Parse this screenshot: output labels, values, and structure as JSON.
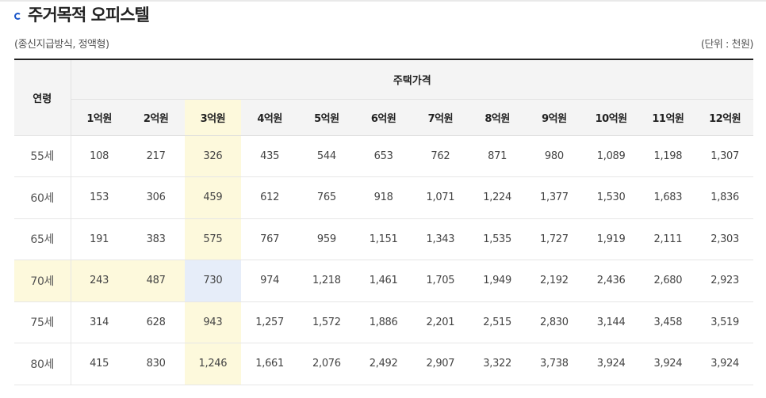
{
  "title": "주거목적 오피스텔",
  "subtitle_left": "(종신지급방식, 정액형)",
  "subtitle_right": "(단위 : 천원)",
  "colors": {
    "bullet": "#1a56c9",
    "highlight": "#fdf9dc",
    "intersection": "#e6edf9"
  },
  "table": {
    "age_header": "연령",
    "group_header": "주택가격",
    "columns": [
      "1억원",
      "2억원",
      "3억원",
      "4억원",
      "5억원",
      "6억원",
      "7억원",
      "8억원",
      "9억원",
      "10억원",
      "11억원",
      "12억원"
    ],
    "highlight_column_index": 2,
    "highlight_row_index": 3,
    "rows": [
      {
        "age": "55세",
        "values": [
          "108",
          "217",
          "326",
          "435",
          "544",
          "653",
          "762",
          "871",
          "980",
          "1,089",
          "1,198",
          "1,307"
        ]
      },
      {
        "age": "60세",
        "values": [
          "153",
          "306",
          "459",
          "612",
          "765",
          "918",
          "1,071",
          "1,224",
          "1,377",
          "1,530",
          "1,683",
          "1,836"
        ]
      },
      {
        "age": "65세",
        "values": [
          "191",
          "383",
          "575",
          "767",
          "959",
          "1,151",
          "1,343",
          "1,535",
          "1,727",
          "1,919",
          "2,111",
          "2,303"
        ]
      },
      {
        "age": "70세",
        "values": [
          "243",
          "487",
          "730",
          "974",
          "1,218",
          "1,461",
          "1,705",
          "1,949",
          "2,192",
          "2,436",
          "2,680",
          "2,923"
        ]
      },
      {
        "age": "75세",
        "values": [
          "314",
          "628",
          "943",
          "1,257",
          "1,572",
          "1,886",
          "2,201",
          "2,515",
          "2,830",
          "3,144",
          "3,458",
          "3,519"
        ]
      },
      {
        "age": "80세",
        "values": [
          "415",
          "830",
          "1,246",
          "1,661",
          "2,076",
          "2,492",
          "2,907",
          "3,322",
          "3,738",
          "3,924",
          "3,924",
          "3,924"
        ]
      }
    ]
  }
}
